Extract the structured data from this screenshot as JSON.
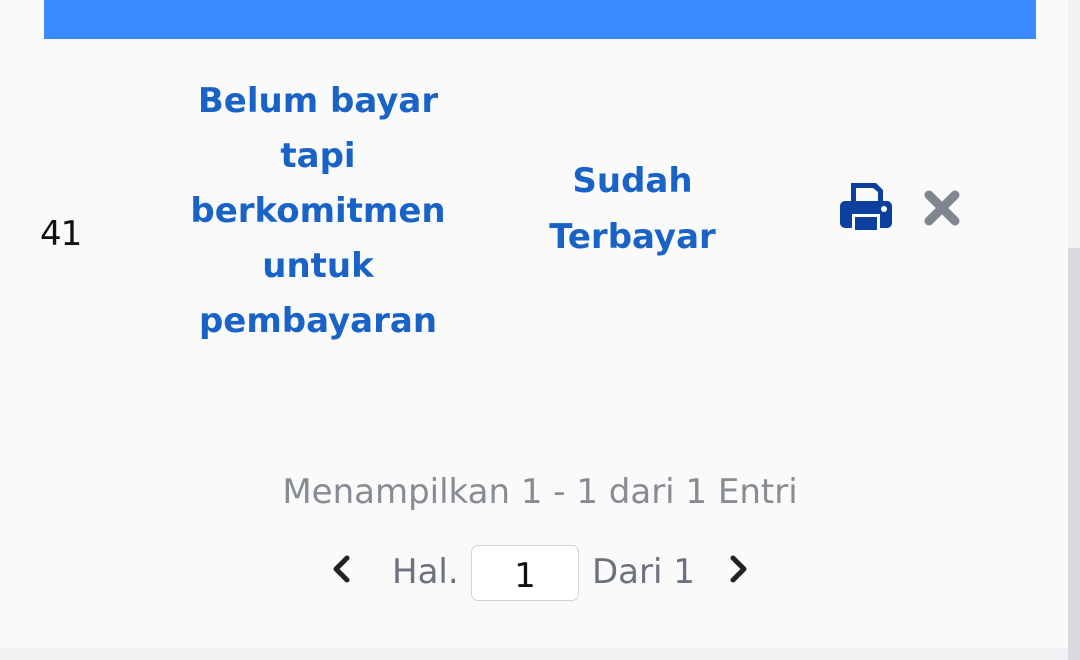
{
  "table": {
    "row": {
      "id_fragment": "41",
      "status_description": "Belum bayar tapi berkomitmen untuk pembayaran",
      "status_paid": "Sudah Terbayar"
    }
  },
  "icons": {
    "print": "print-icon",
    "delete": "close-icon"
  },
  "colors": {
    "header_bar": "#3a8bff",
    "status_text": "#1a63c6",
    "print_icon": "#0d3f9e",
    "delete_icon": "#80868f"
  },
  "pagination": {
    "summary": "Menampilkan 1 - 1 dari 1 Entri",
    "page_label": "Hal.",
    "current_page": "1",
    "total_label": "Dari 1"
  }
}
